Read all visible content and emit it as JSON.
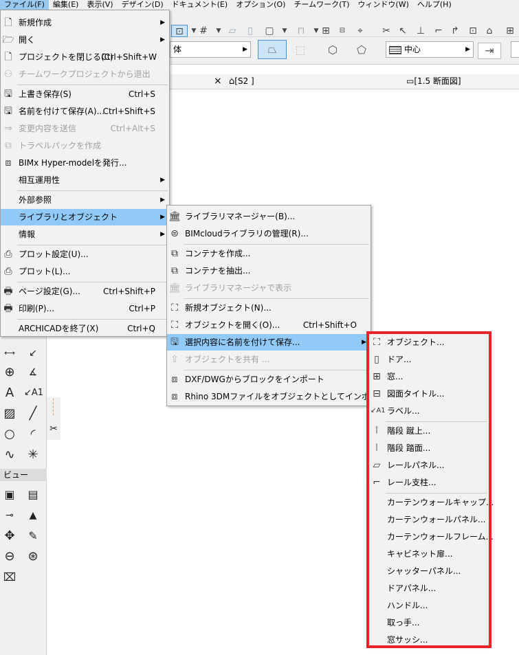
{
  "menubar": {
    "items": [
      {
        "label": "ファイル(F)",
        "active": true
      },
      {
        "label": "編集(E)"
      },
      {
        "label": "表示(V)"
      },
      {
        "label": "デザイン(D)"
      },
      {
        "label": "ドキュメント(E)"
      },
      {
        "label": "オプション(O)"
      },
      {
        "label": "チームワーク(T)"
      },
      {
        "label": "ウィンドウ(W)"
      },
      {
        "label": "ヘルプ(H)"
      }
    ]
  },
  "infobar": {
    "combo1": "体",
    "combo2": "中心"
  },
  "tabbar": {
    "close": "×",
    "tab1": "[S2 ]",
    "tab2": "[1.5 断面図]"
  },
  "toolbox": {
    "section_label": "ビュー",
    "a1_label": "A1"
  },
  "file_menu": {
    "items": [
      {
        "label": "新規作成",
        "icon": "new-file-icon",
        "submenu": true
      },
      {
        "label": "開く",
        "icon": "open-folder-icon",
        "submenu": true
      },
      {
        "label": "プロジェクトを閉じる(C)",
        "shortcut": "Ctrl+Shift+W",
        "icon": "close-project-icon"
      },
      {
        "label": "チームワークプロジェクトから退出",
        "disabled": true,
        "icon": "leave-teamwork-icon"
      },
      {
        "label": "上書き保存(S)",
        "shortcut": "Ctrl+S",
        "icon": "save-icon"
      },
      {
        "label": "名前を付けて保存(A)...",
        "shortcut": "Ctrl+Shift+S",
        "icon": "save-as-icon"
      },
      {
        "label": "変更内容を送信",
        "shortcut": "Ctrl+Alt+S",
        "disabled": true,
        "icon": "send-changes-icon"
      },
      {
        "label": "トラベルパックを作成",
        "disabled": true,
        "icon": "travel-pack-icon"
      },
      {
        "label": "BIMx Hyper-modelを発行...",
        "icon": "bimx-icon"
      },
      {
        "label": "相互運用性",
        "submenu": true
      },
      {
        "label": "外部参照",
        "submenu": true
      },
      {
        "label": "ライブラリとオブジェクト",
        "submenu": true,
        "highlighted": true
      },
      {
        "label": "情報",
        "submenu": true
      },
      {
        "label": "プロット設定(U)...",
        "icon": "plot-setup-icon"
      },
      {
        "label": "プロット(L)...",
        "icon": "plot-icon"
      },
      {
        "label": "ページ設定(G)...",
        "shortcut": "Ctrl+Shift+P",
        "icon": "page-setup-icon"
      },
      {
        "label": "印刷(P)...",
        "shortcut": "Ctrl+P",
        "icon": "print-icon"
      },
      {
        "label": "ARCHICADを終了(X)",
        "shortcut": "Ctrl+Q"
      }
    ]
  },
  "library_menu": {
    "items": [
      {
        "label": "ライブラリマネージャー(B)...",
        "icon": "library-manager-icon"
      },
      {
        "label": "BIMcloudライブラリの管理(R)...",
        "icon": "bimcloud-library-icon"
      },
      {
        "label": "コンテナを作成...",
        "icon": "create-container-icon"
      },
      {
        "label": "コンテナを抽出...",
        "icon": "extract-container-icon"
      },
      {
        "label": "ライブラリマネージャで表示",
        "disabled": true,
        "icon": "show-in-library-icon"
      },
      {
        "label": "新規オブジェクト(N)...",
        "icon": "new-object-icon"
      },
      {
        "label": "オブジェクトを開く(O)...",
        "shortcut": "Ctrl+Shift+O",
        "icon": "open-object-icon"
      },
      {
        "label": "選択内容に名前を付けて保存...",
        "submenu": true,
        "highlighted": true,
        "icon": "save-selection-icon"
      },
      {
        "label": "オブジェクトを共有 ...",
        "disabled": true,
        "icon": "share-object-icon"
      },
      {
        "label": "DXF/DWGからブロックをインポート",
        "icon": "import-dwg-icon"
      },
      {
        "label": "Rhino 3DMファイルをオブジェクトとしてインポート...",
        "icon": "import-rhino-icon"
      }
    ]
  },
  "save_selection_menu": {
    "items": [
      {
        "label": "オブジェクト...",
        "icon": "object-icon"
      },
      {
        "label": "ドア...",
        "icon": "door-icon"
      },
      {
        "label": "窓...",
        "icon": "window-icon"
      },
      {
        "label": "図面タイトル...",
        "icon": "drawing-title-icon"
      },
      {
        "label": "ラベル...",
        "icon": "label-icon"
      },
      {
        "label": "階段 蹴上...",
        "icon": "stair-riser-icon"
      },
      {
        "label": "階段 踏面...",
        "icon": "stair-tread-icon"
      },
      {
        "label": "レールパネル...",
        "icon": "rail-panel-icon"
      },
      {
        "label": "レール支柱...",
        "icon": "rail-post-icon"
      },
      {
        "label": "カーテンウォールキャップ..."
      },
      {
        "label": "カーテンウォールパネル..."
      },
      {
        "label": "カーテンウォールフレーム..."
      },
      {
        "label": "キャビネット扉..."
      },
      {
        "label": "シャッターパネル..."
      },
      {
        "label": "ドアパネル..."
      },
      {
        "label": "ハンドル..."
      },
      {
        "label": "取っ手..."
      },
      {
        "label": "窓サッシ..."
      }
    ]
  }
}
